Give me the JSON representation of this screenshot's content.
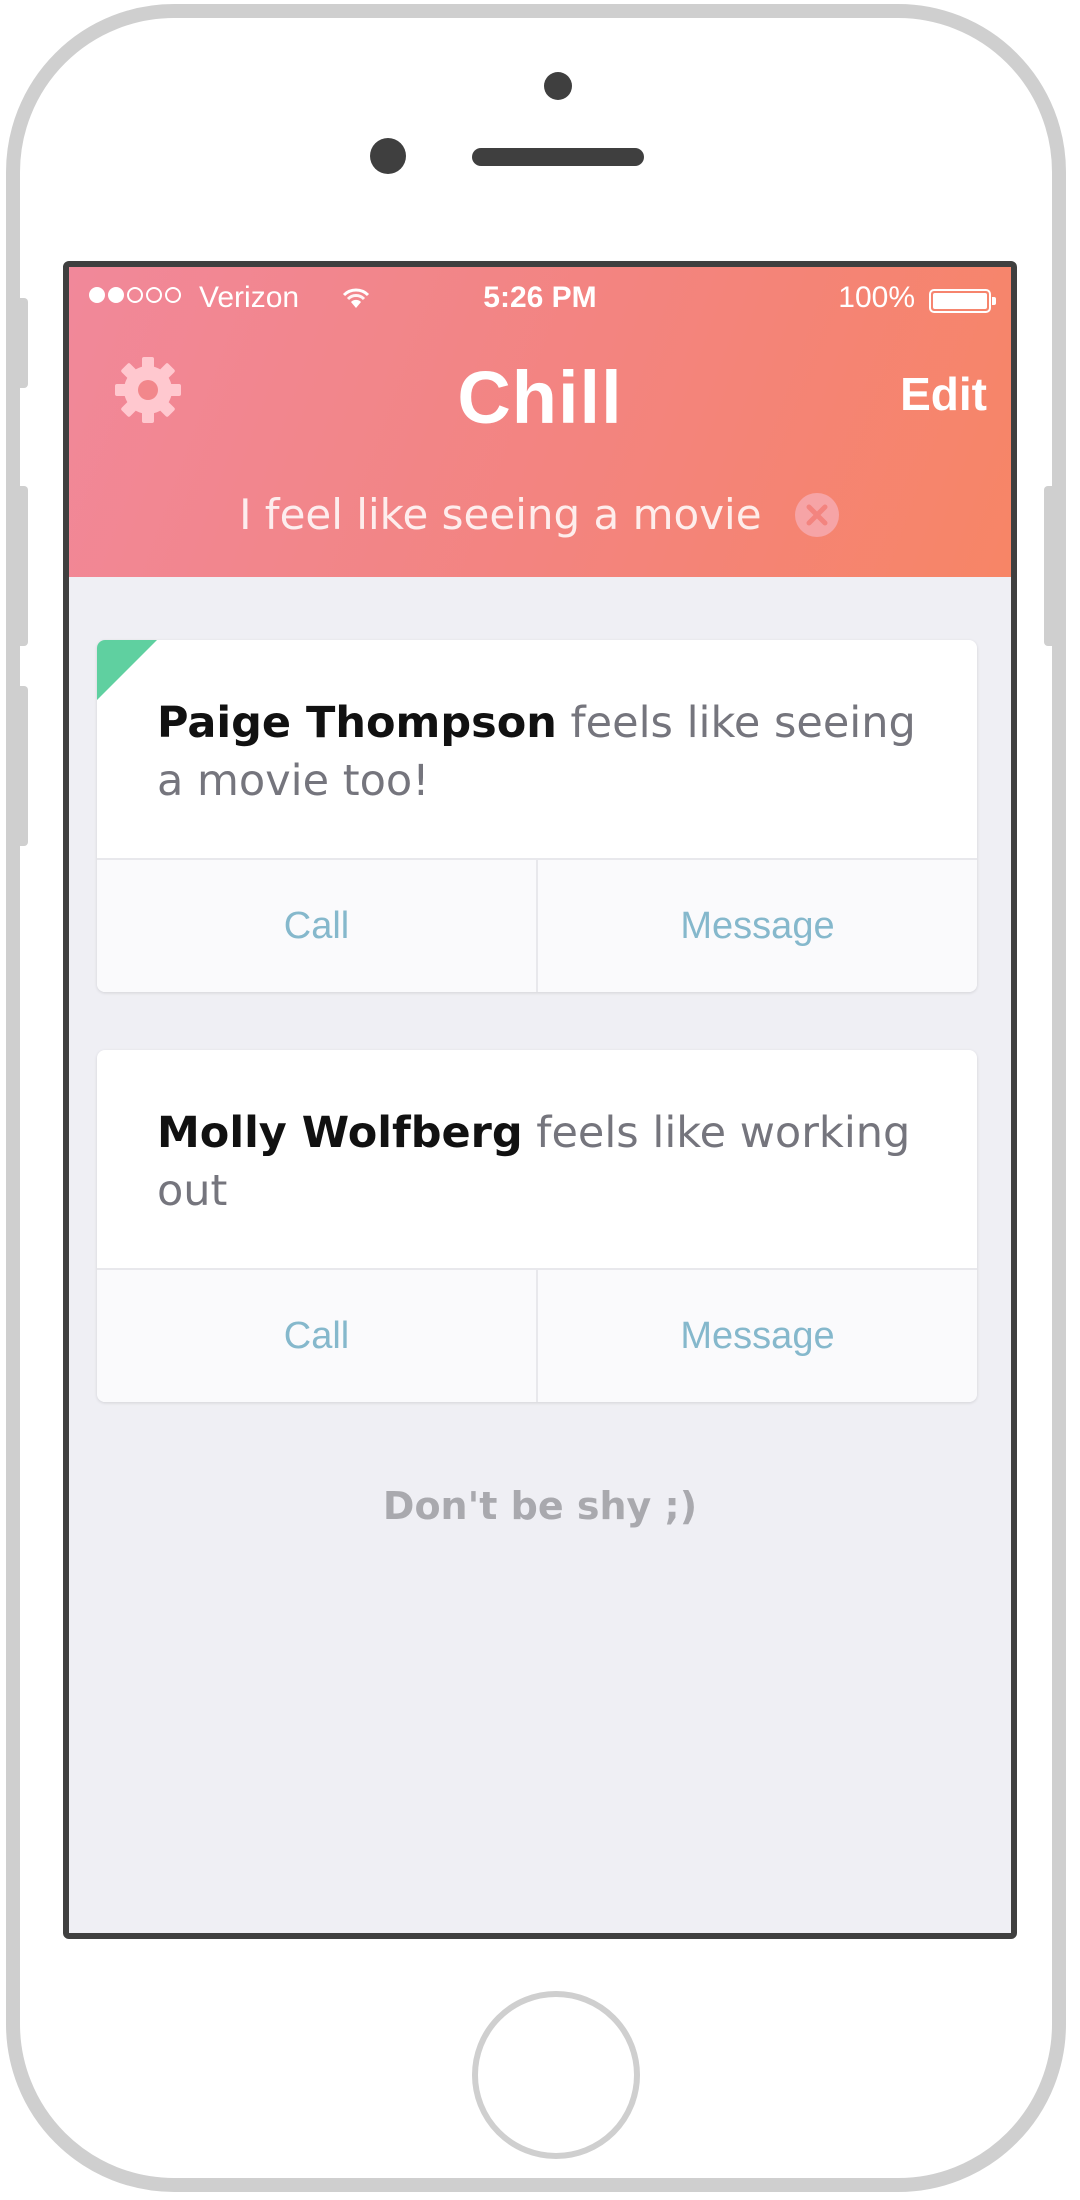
{
  "status_bar": {
    "carrier": "Verizon",
    "signal_bars_on": 2,
    "signal_bars_total": 5,
    "time": "5:26 PM",
    "battery": "100%",
    "icons": [
      "wifi-icon",
      "battery-icon"
    ]
  },
  "header": {
    "title": "Chill",
    "edit_label": "Edit",
    "settings_icon": "gear-icon",
    "feeling": "I feel like seeing a movie",
    "clear_icon": "clear-x-icon"
  },
  "cards": [
    {
      "name": "Paige Thompson",
      "status": " feels like seeing a movie too!",
      "is_new": true,
      "call_label": "Call",
      "message_label": "Message"
    },
    {
      "name": "Molly Wolfberg",
      "status": " feels like working out",
      "is_new": false,
      "call_label": "Call",
      "message_label": "Message"
    }
  ],
  "footer_note": "Don't be shy ;)",
  "colors": {
    "header_start": "#f1889a",
    "header_end": "#f78566",
    "new_flag": "#5fd0a0",
    "action_text": "#85b8cc",
    "background": "#efeff4"
  }
}
